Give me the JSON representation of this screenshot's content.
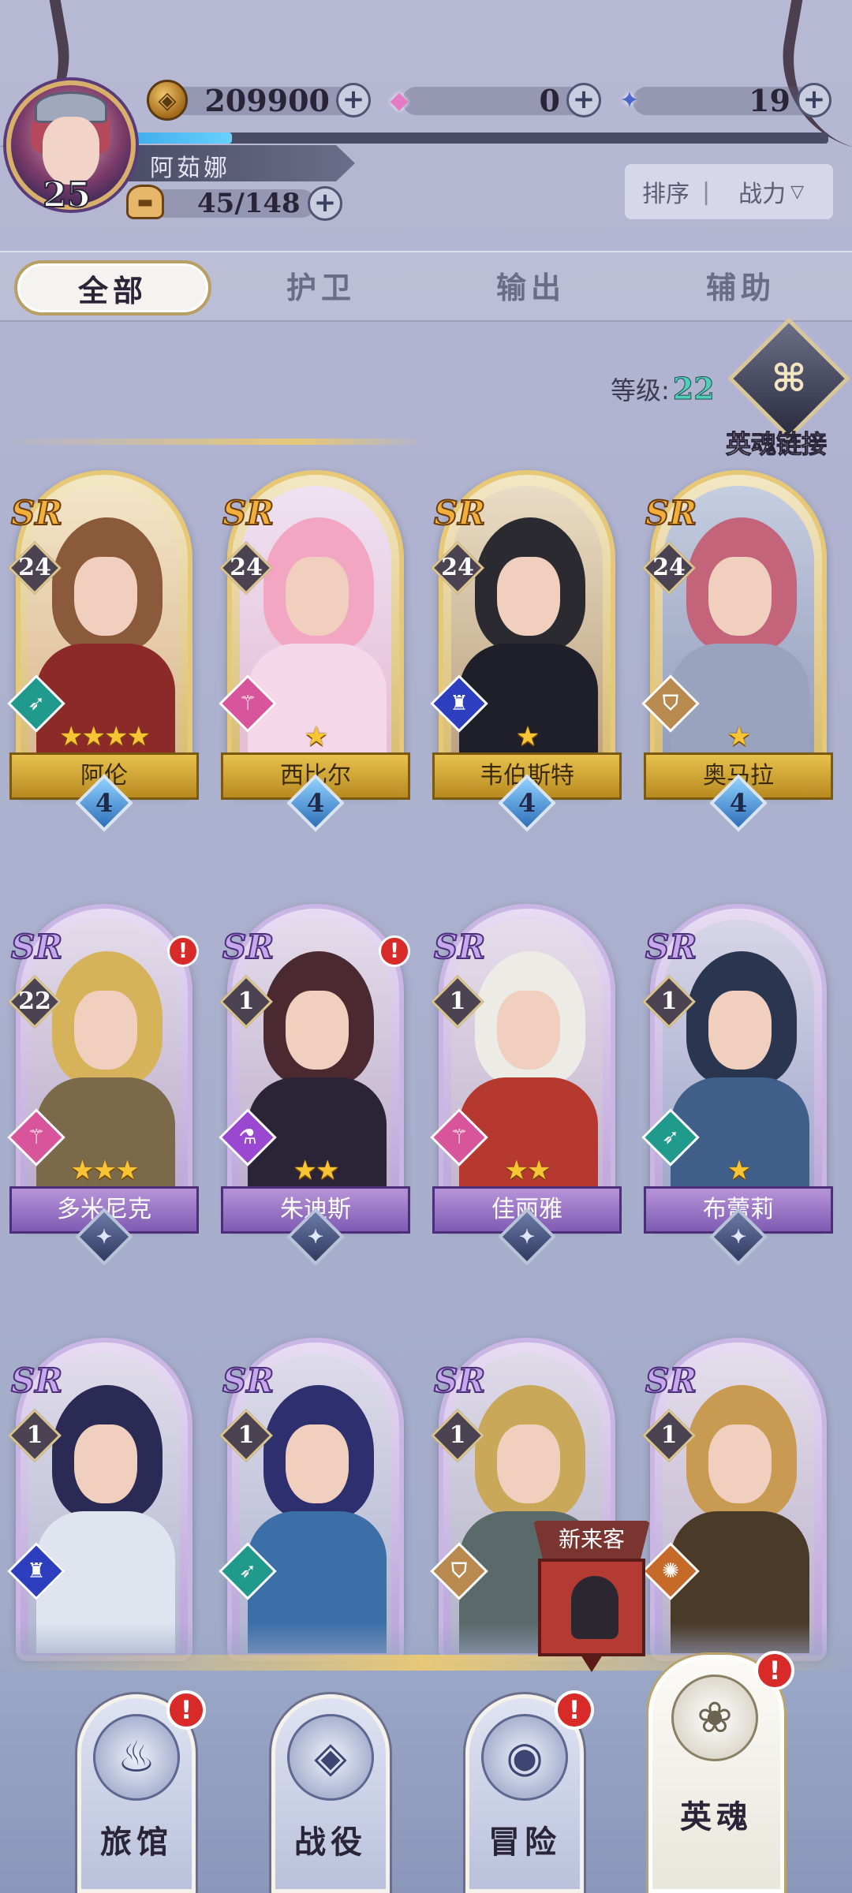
{
  "resources": {
    "gold": "209900",
    "gems": "0",
    "stars": "19",
    "stamina": "45/148",
    "plus_label": "+"
  },
  "player": {
    "name": "阿茹娜",
    "level": "25",
    "xp_progress": 0.16
  },
  "sort": {
    "label": "排序",
    "separator": "|",
    "value": "战力",
    "arrow": "▽"
  },
  "tabs": [
    {
      "label": "全部",
      "active": true
    },
    {
      "label": "护卫",
      "active": false
    },
    {
      "label": "输出",
      "active": false
    },
    {
      "label": "辅助",
      "active": false
    }
  ],
  "soul_link": {
    "level_label": "等级:",
    "level_value": "22",
    "label": "英魂链接"
  },
  "heroes": [
    {
      "name": "阿伦",
      "rank": "SR",
      "level": "24",
      "stars": "★★★★",
      "gem": "4",
      "role_icon": "bow-icon",
      "tier": "gold"
    },
    {
      "name": "西比尔",
      "rank": "SR",
      "level": "24",
      "stars": "★",
      "gem": "4",
      "role_icon": "staff-icon",
      "tier": "gold"
    },
    {
      "name": "韦伯斯特",
      "rank": "SR",
      "level": "24",
      "stars": "★",
      "gem": "4",
      "role_icon": "hat-icon",
      "tier": "gold"
    },
    {
      "name": "奥马拉",
      "rank": "SR",
      "level": "24",
      "stars": "★",
      "gem": "4",
      "role_icon": "shield-icon",
      "tier": "gold"
    },
    {
      "name": "多米尼克",
      "rank": "SR",
      "level": "22",
      "stars": "★★★",
      "gem": "✦",
      "role_icon": "staff-icon",
      "tier": "purple",
      "alert": "!"
    },
    {
      "name": "朱迪斯",
      "rank": "SR",
      "level": "1",
      "stars": "★★",
      "gem": "✦",
      "role_icon": "potion-icon",
      "tier": "purple",
      "alert": "!"
    },
    {
      "name": "佳丽雅",
      "rank": "SR",
      "level": "1",
      "stars": "★★",
      "gem": "✦",
      "role_icon": "staff-icon",
      "tier": "purple"
    },
    {
      "name": "布蕾莉",
      "rank": "SR",
      "level": "1",
      "stars": "★",
      "gem": "✦",
      "role_icon": "bow-icon",
      "tier": "purple"
    },
    {
      "rank": "SR",
      "level": "1",
      "role_icon": "hat-icon",
      "tier": "purple"
    },
    {
      "rank": "SR",
      "level": "1",
      "role_icon": "bow-icon",
      "tier": "purple"
    },
    {
      "rank": "SR",
      "level": "1",
      "role_icon": "shield-icon",
      "tier": "purple"
    },
    {
      "rank": "SR",
      "level": "1",
      "role_icon": "swirl-icon",
      "tier": "purple"
    }
  ],
  "new_visitor": {
    "label": "新来客"
  },
  "nav": [
    {
      "label": "旅馆",
      "icon": "mug-icon",
      "alert": "!",
      "active": false
    },
    {
      "label": "战役",
      "icon": "banner-icon",
      "alert": "",
      "active": false
    },
    {
      "label": "冒险",
      "icon": "portal-icon",
      "alert": "!",
      "active": false
    },
    {
      "label": "英魂",
      "icon": "rose-icon",
      "alert": "!",
      "active": true
    }
  ],
  "icons": {
    "coin": "coin-icon",
    "gem": "gem-icon",
    "star": "star-icon",
    "bread": "bread-icon",
    "soul_link": "chain-link-icon"
  }
}
